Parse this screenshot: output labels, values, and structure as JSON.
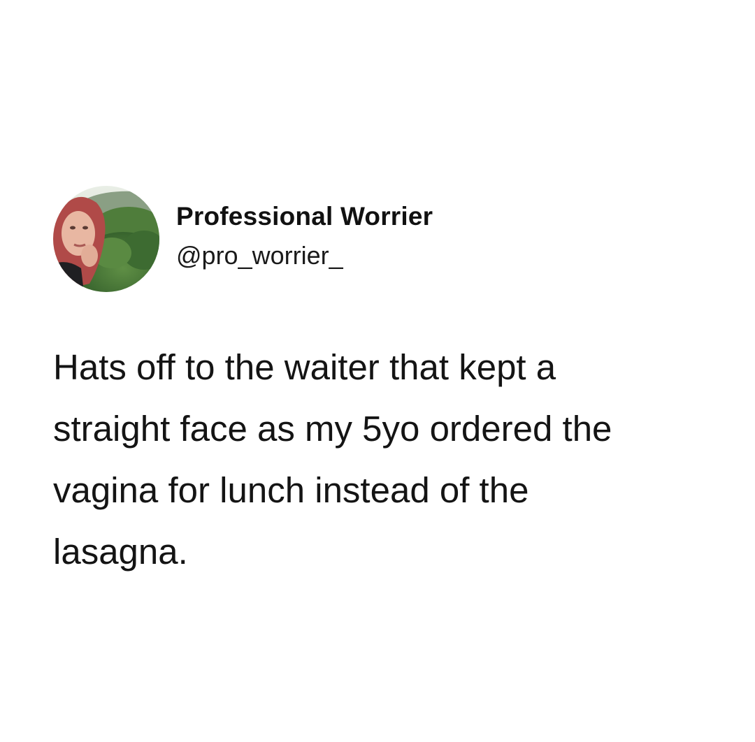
{
  "tweet": {
    "author": {
      "display_name": "Professional Worrier",
      "handle": "@pro_worrier_"
    },
    "text_lines": [
      "Hats off to the waiter that kept a",
      "straight face as my 5yo ordered the",
      "vagina for lunch instead of the",
      "lasagna."
    ]
  },
  "colors": {
    "background": "#ffffff",
    "text": "#141414"
  }
}
